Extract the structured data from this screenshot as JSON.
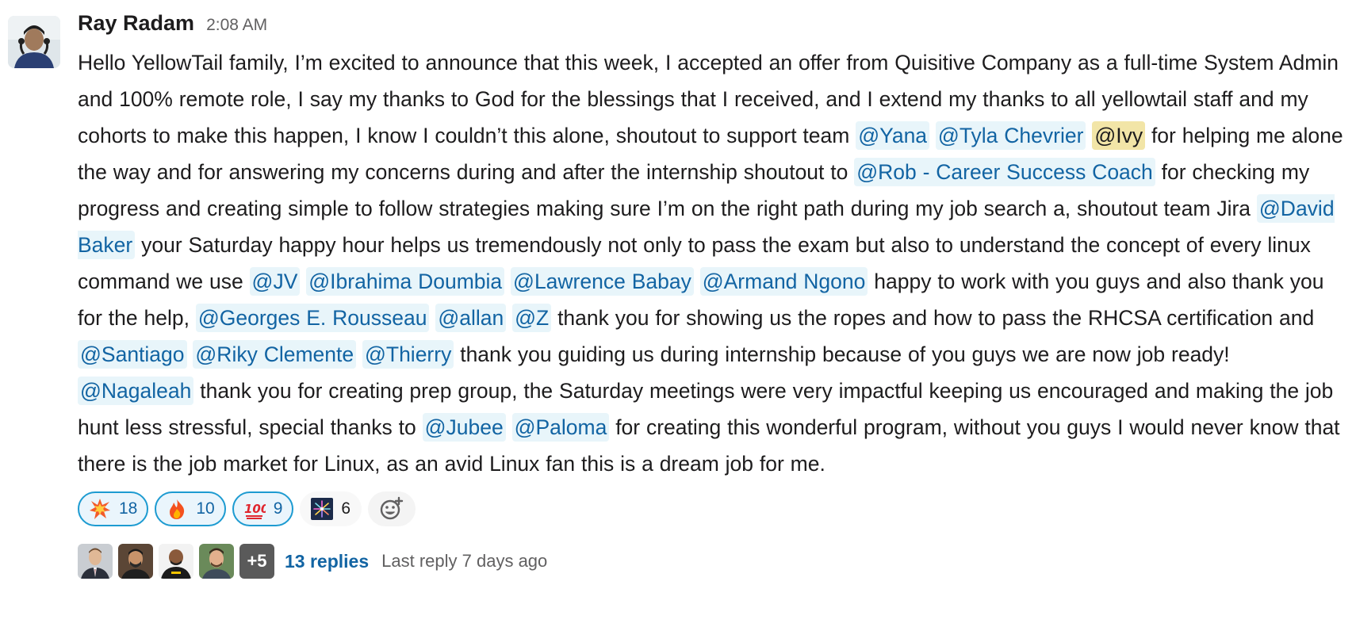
{
  "message": {
    "author": "Ray Radam",
    "timestamp": "2:08 AM",
    "segments": [
      {
        "type": "text",
        "text": "Hello YellowTail family, I’m excited to announce that this week, I accepted an offer from Quisitive Company as a full-time System Admin and 100% remote role, I say my thanks to God for the blessings that I received, and I extend my thanks to all yellowtail staff  and my cohorts to make this happen, I know I couldn’t this alone, shoutout to support team "
      },
      {
        "type": "mention",
        "text": "@Yana"
      },
      {
        "type": "text",
        "text": " "
      },
      {
        "type": "mention",
        "text": "@Tyla Chevrier"
      },
      {
        "type": "text",
        "text": " "
      },
      {
        "type": "mention-self",
        "text": "@Ivy"
      },
      {
        "type": "text",
        "text": " for helping me alone the way and for answering my concerns during and after the internship shoutout to "
      },
      {
        "type": "mention",
        "text": "@Rob - Career Success Coach"
      },
      {
        "type": "text",
        "text": " for checking my progress and creating simple to follow strategies  making sure I’m on the right path during my job search a, shoutout team Jira "
      },
      {
        "type": "mention",
        "text": "@David Baker"
      },
      {
        "type": "text",
        "text": " your Saturday happy hour helps us tremendously not only to pass the exam but also to understand the concept of every linux command we use "
      },
      {
        "type": "mention",
        "text": "@JV"
      },
      {
        "type": "text",
        "text": " "
      },
      {
        "type": "mention",
        "text": "@Ibrahima Doumbia"
      },
      {
        "type": "text",
        "text": " "
      },
      {
        "type": "mention",
        "text": "@Lawrence Babay"
      },
      {
        "type": "text",
        "text": " "
      },
      {
        "type": "mention",
        "text": "@Armand Ngono"
      },
      {
        "type": "text",
        "text": " happy to work with you guys and also thank you for the help, "
      },
      {
        "type": "mention",
        "text": "@Georges E. Rousseau"
      },
      {
        "type": "text",
        "text": " "
      },
      {
        "type": "mention",
        "text": "@allan"
      },
      {
        "type": "text",
        "text": " "
      },
      {
        "type": "mention",
        "text": "@Z"
      },
      {
        "type": "text",
        "text": " thank you for showing us the ropes and how  to pass the RHCSA certification and "
      },
      {
        "type": "mention",
        "text": "@Santiago"
      },
      {
        "type": "text",
        "text": " "
      },
      {
        "type": "mention",
        "text": "@Riky Clemente"
      },
      {
        "type": "text",
        "text": " "
      },
      {
        "type": "mention",
        "text": "@Thierry"
      },
      {
        "type": "text",
        "text": " thank you guiding us during internship because of you guys we are now job ready!  "
      },
      {
        "type": "mention",
        "text": "@Nagaleah"
      },
      {
        "type": "text",
        "text": " thank you for creating prep group,  the Saturday meetings were very impactful keeping us encouraged and making the job hunt less stressful, special thanks to "
      },
      {
        "type": "mention",
        "text": "@Jubee"
      },
      {
        "type": "text",
        "text": " "
      },
      {
        "type": "mention",
        "text": "@Paloma"
      },
      {
        "type": "text",
        "text": " for creating this wonderful program, without you guys  I would never know that there is the job market for Linux, as an avid Linux fan this is a dream job for me."
      }
    ]
  },
  "reactions": [
    {
      "emoji": "collision-icon",
      "count": "18",
      "mine": true
    },
    {
      "emoji": "fire-icon",
      "count": "10",
      "mine": true
    },
    {
      "emoji": "hundred-points-icon",
      "count": "9",
      "mine": true
    },
    {
      "emoji": "fireworks-icon",
      "count": "6",
      "mine": false
    }
  ],
  "thread": {
    "repliers": [
      "replier-avatar-1",
      "replier-avatar-2",
      "replier-avatar-3",
      "replier-avatar-4"
    ],
    "more_count": "+5",
    "replies_label": "13 replies",
    "last_reply": "Last reply 7 days ago"
  },
  "colors": {
    "link": "#1264a3",
    "mention_bg": "#e8f5fa",
    "self_mention_bg": "#f2e5a7",
    "reaction_border": "#1d9bd1"
  }
}
